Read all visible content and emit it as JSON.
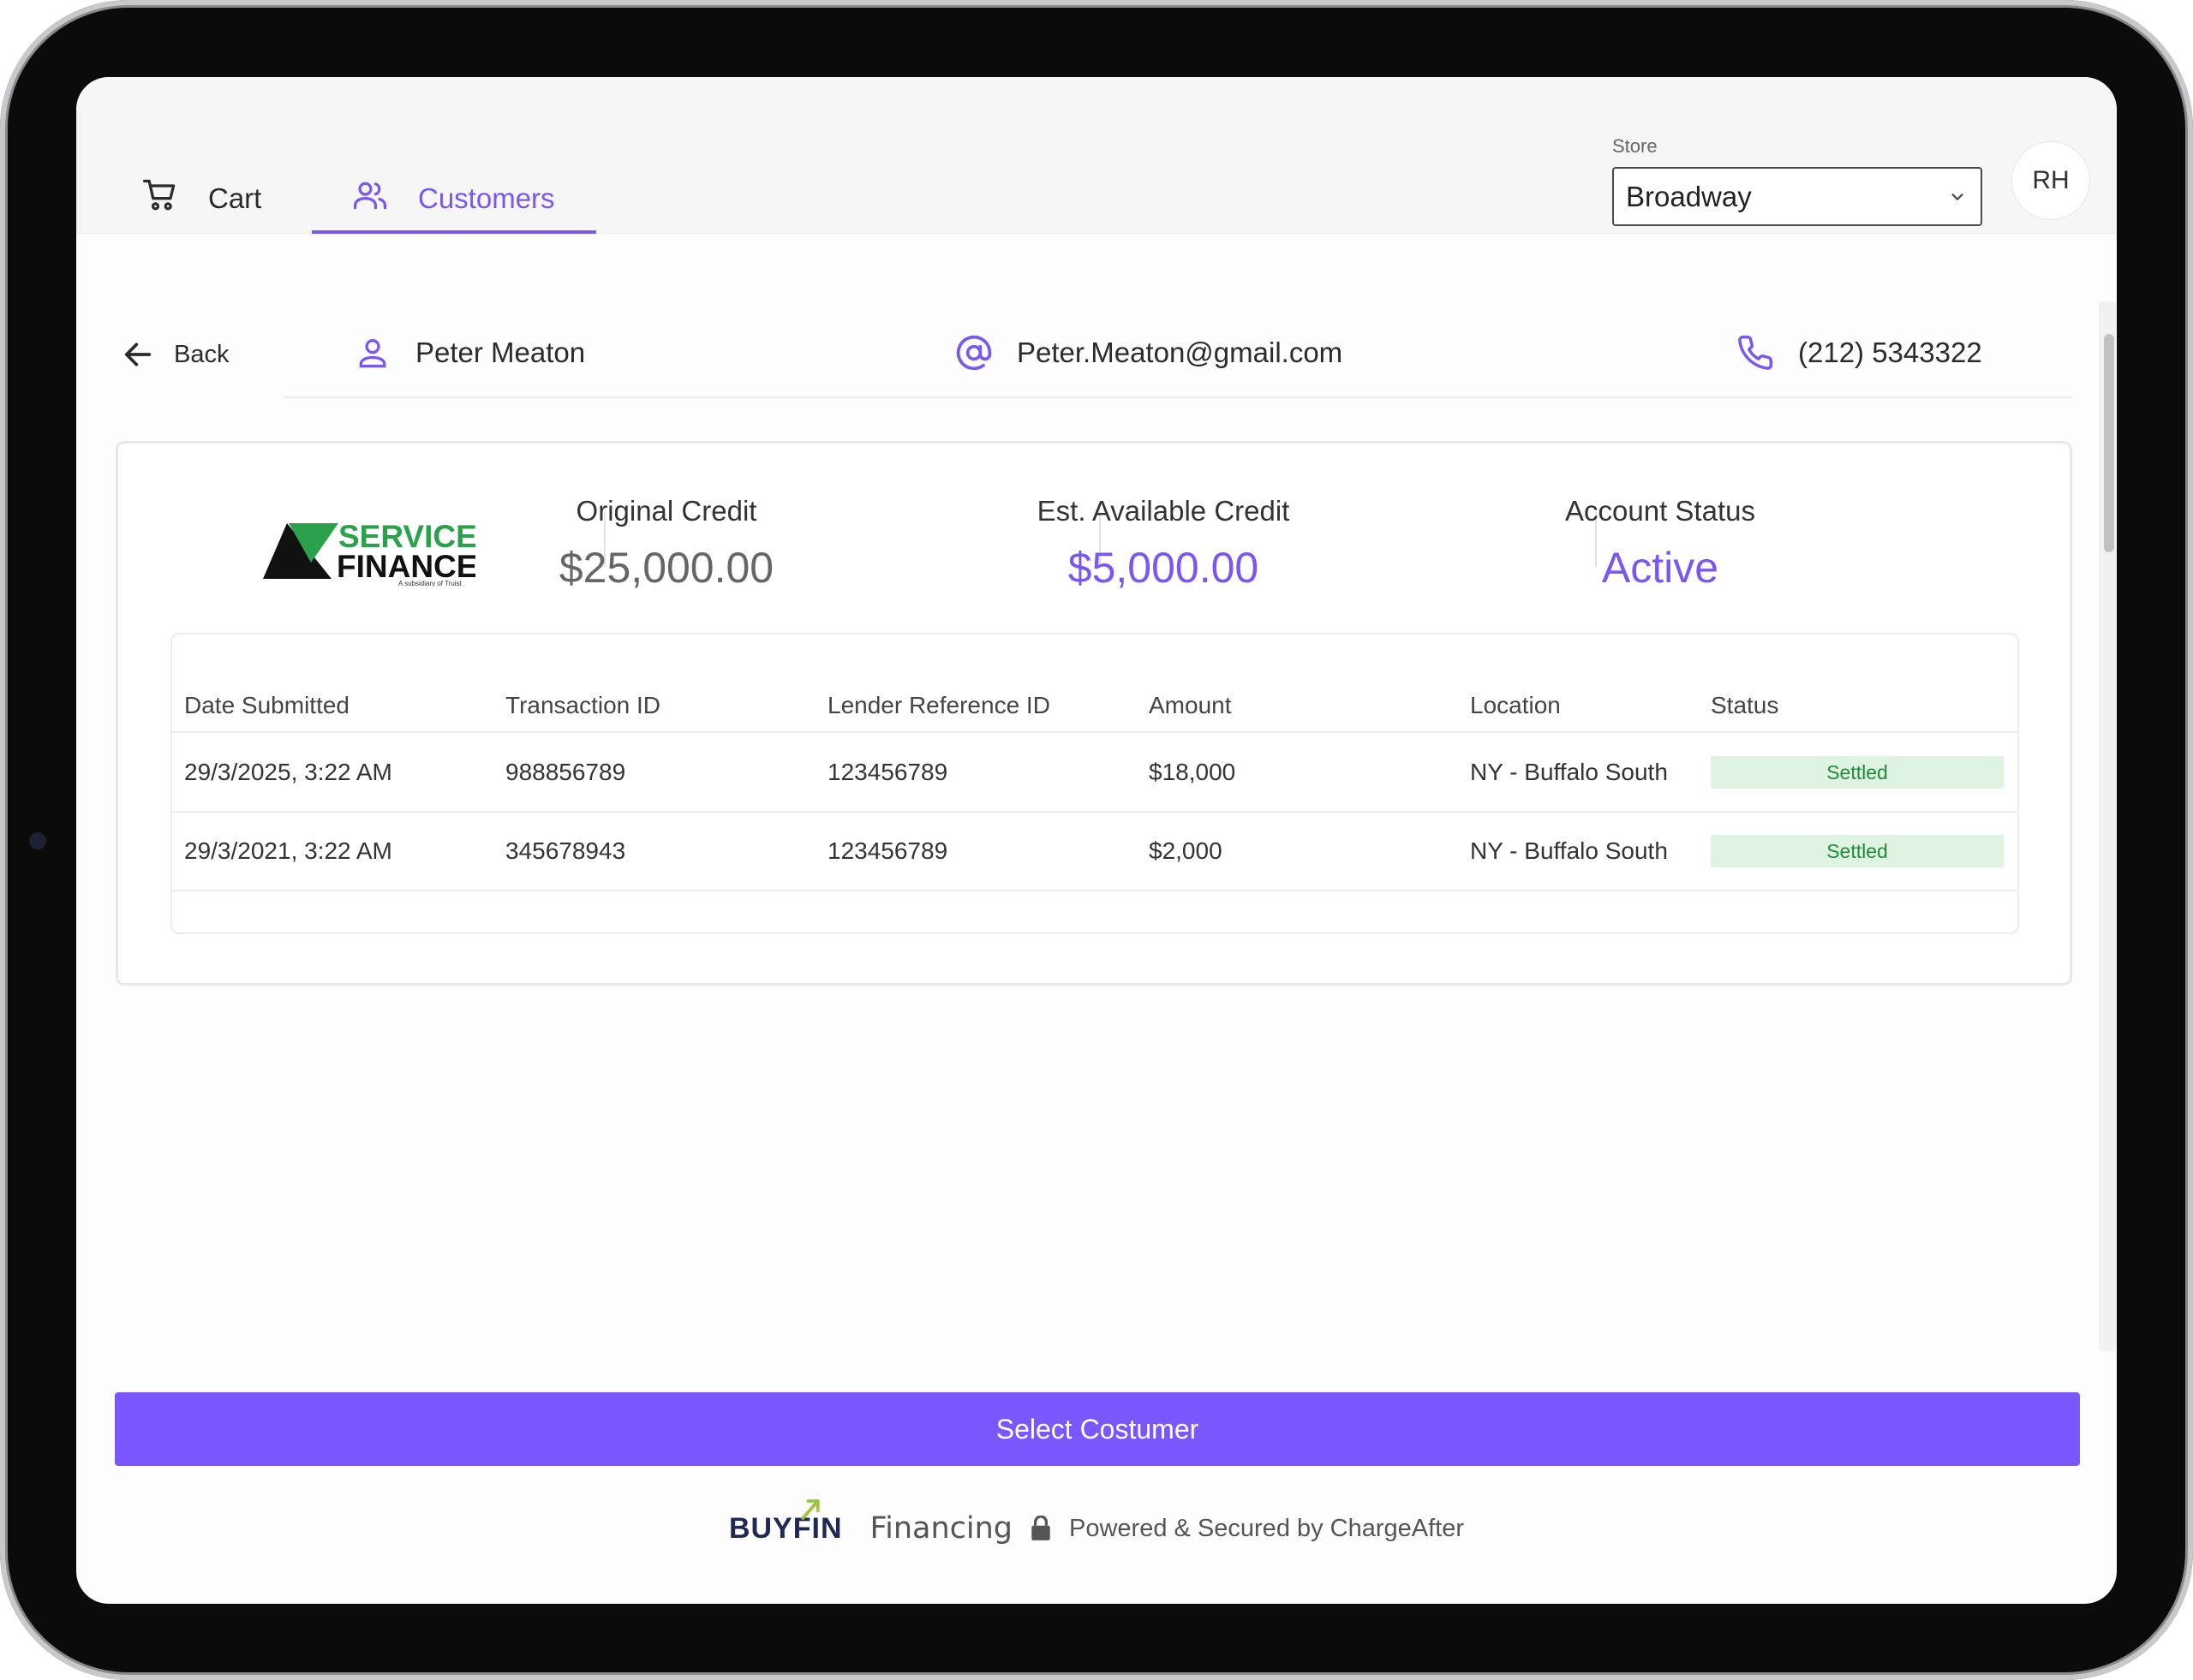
{
  "nav": {
    "tabs": [
      {
        "label": "Cart",
        "icon": "cart-icon",
        "active": false
      },
      {
        "label": "Customers",
        "icon": "users-icon",
        "active": true
      }
    ],
    "store_label": "Store",
    "store_value": "Broadway",
    "avatar_initials": "RH",
    "accent_color": "#7a57f0"
  },
  "customer": {
    "back_label": "Back",
    "name": "Peter Meaton",
    "email": "Peter.Meaton@gmail.com",
    "phone": "(212) 5343322"
  },
  "account": {
    "lender_logo_text": [
      "SERVICE",
      "FINANCE"
    ],
    "lender_logo_subtitle": "A subsidiary of Truist",
    "stats": [
      {
        "label": "Original Credit",
        "value": "$25,000.00"
      },
      {
        "label": "Est. Available Credit",
        "value": "$5,000.00"
      },
      {
        "label": "Account Status",
        "value": "Active"
      }
    ]
  },
  "transactions": {
    "columns": [
      "Date Submitted",
      "Transaction ID",
      "Lender Reference ID",
      "Amount",
      "Location",
      "Status"
    ],
    "rows": [
      {
        "date": "29/3/2025, 3:22 AM",
        "transaction_id": "988856789",
        "lender_ref": "123456789",
        "amount": "$18,000",
        "location": "NY - Buffalo South",
        "status": "Settled"
      },
      {
        "date": "29/3/2021, 3:22 AM",
        "transaction_id": "345678943",
        "lender_ref": "123456789",
        "amount": "$2,000",
        "location": "NY - Buffalo South",
        "status": "Settled"
      }
    ],
    "status_color": "#1f8a3a"
  },
  "actions": {
    "select_label": "Select Costumer",
    "button_color": "#7a57fd"
  },
  "footer": {
    "brand": "BUYFIN",
    "financing": "Financing",
    "powered": "Powered & Secured by ChargeAfter"
  }
}
